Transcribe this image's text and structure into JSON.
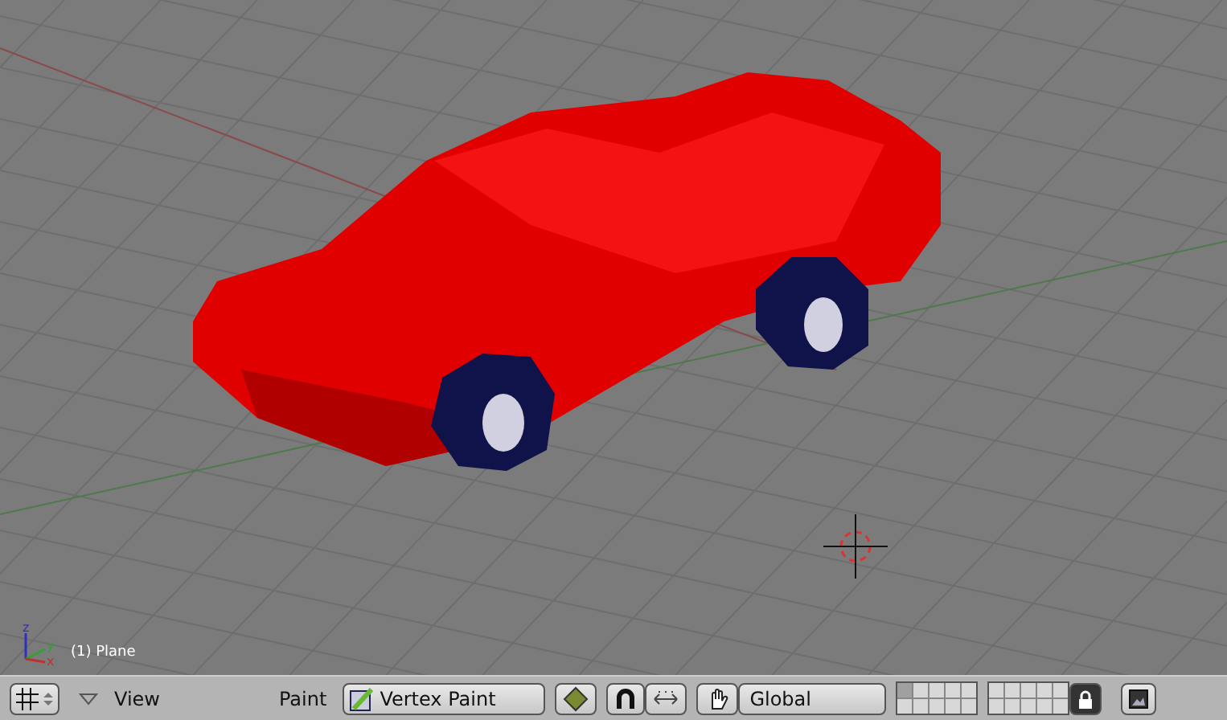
{
  "viewport": {
    "object_label": "(1) Plane",
    "axis_labels": [
      "z",
      "y",
      "x"
    ]
  },
  "header": {
    "view_menu": "View",
    "mode_label": "Paint",
    "mode": "Vertex Paint",
    "orientation": "Global",
    "layers": [
      {
        "selected": true
      },
      {
        "selected": false
      },
      {
        "selected": false
      },
      {
        "selected": false
      },
      {
        "selected": false
      },
      {
        "selected": false
      },
      {
        "selected": false
      },
      {
        "selected": false
      },
      {
        "selected": false
      },
      {
        "selected": false
      },
      {
        "selected": false
      },
      {
        "selected": false
      },
      {
        "selected": false
      },
      {
        "selected": false
      },
      {
        "selected": false
      },
      {
        "selected": false
      },
      {
        "selected": false
      },
      {
        "selected": false
      },
      {
        "selected": false
      },
      {
        "selected": false
      }
    ],
    "lock": {
      "on": true
    }
  }
}
